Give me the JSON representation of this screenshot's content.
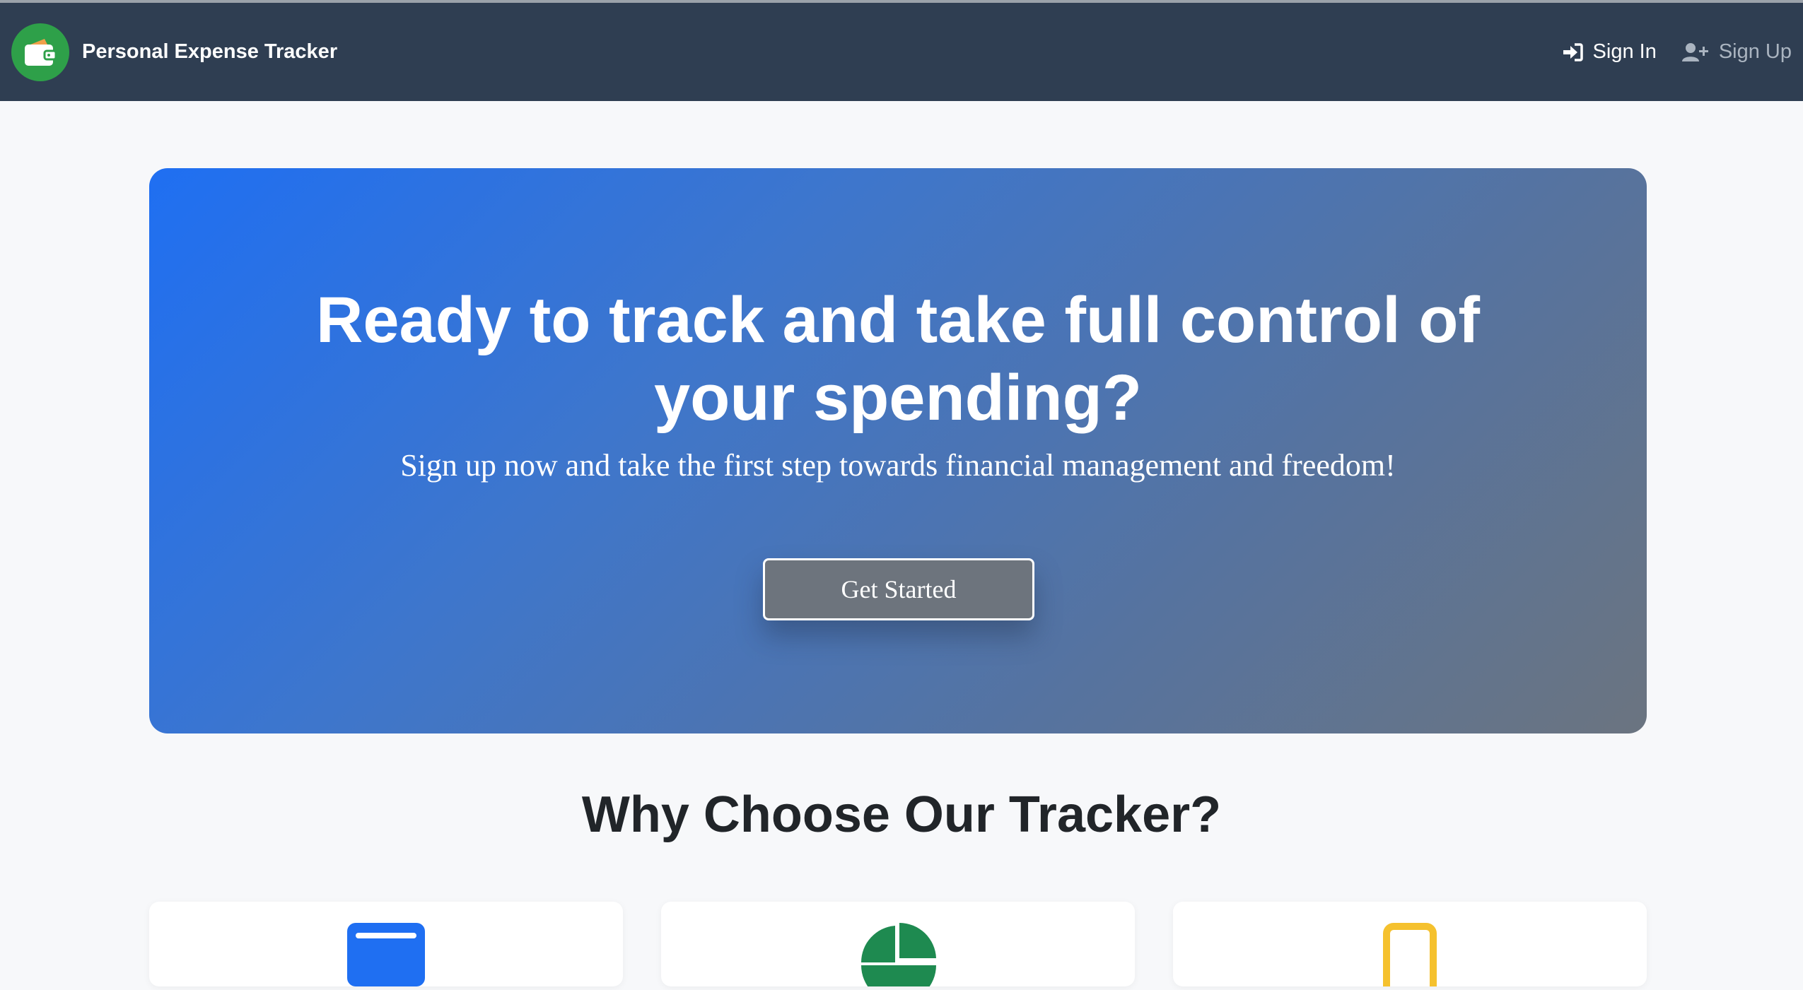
{
  "navbar": {
    "brand_name": "Personal Expense Tracker",
    "brand_icon": "wallet-icon",
    "signin_label": "Sign In",
    "signin_icon": "sign-in-icon",
    "signup_label": "Sign Up",
    "signup_icon": "user-plus-icon"
  },
  "hero": {
    "title": "Ready to track and take full control of your spending?",
    "subtitle": "Sign up now and take the first step towards financial management and freedom!",
    "cta_label": "Get Started"
  },
  "features": {
    "title": "Why Choose Our Tracker?",
    "cards": [
      {
        "icon": "wallet-icon",
        "color": "#1f6ff2"
      },
      {
        "icon": "pie-chart-icon",
        "color": "#1e8a50"
      },
      {
        "icon": "mobile-icon",
        "color": "#f5c12e"
      }
    ]
  },
  "colors": {
    "navbar_bg": "#2f3e52",
    "brand_green": "#2ea049",
    "page_bg": "#f7f8fa"
  }
}
